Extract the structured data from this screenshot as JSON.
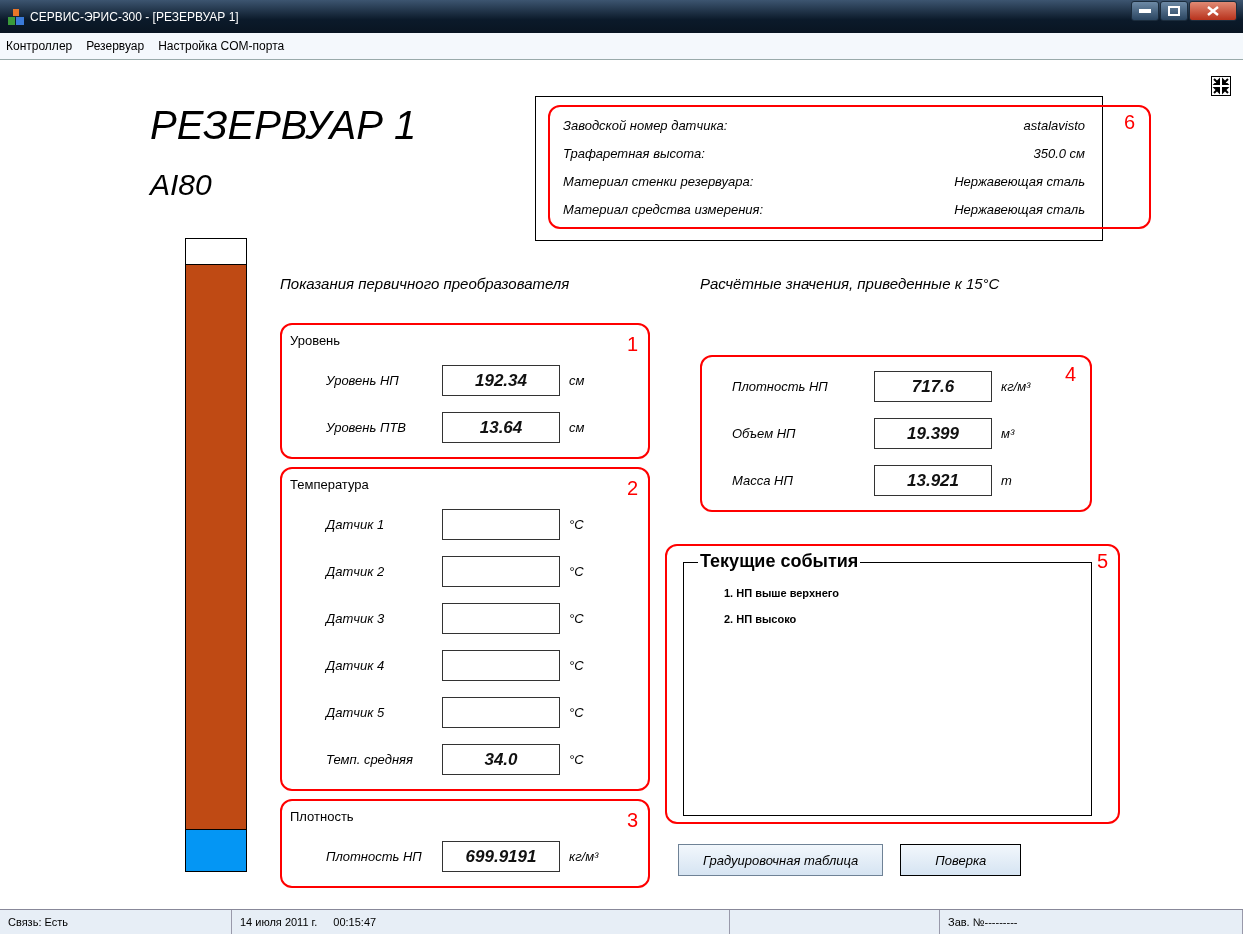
{
  "window": {
    "title": "СЕРВИС-ЭРИС-300 - [РЕЗЕРВУАР 1]"
  },
  "menu": [
    "Контроллер",
    "Резервуар",
    "Настройка COM-порта"
  ],
  "tank": {
    "title": "РЕЗЕРВУАР 1",
    "subtitle": "AI80",
    "product": {
      "level": 0.96
    },
    "water": {
      "level": 0.066
    }
  },
  "info": {
    "annotation": "6",
    "rows": [
      {
        "label": "Заводской номер датчика:",
        "value": "astalavisto"
      },
      {
        "label": "Трафаретная высота:",
        "value": "350.0 см"
      },
      {
        "label": "Материал стенки резервуара:",
        "value": "Нержавеющая сталь"
      },
      {
        "label": "Материал средства измерения:",
        "value": "Нержавеющая сталь"
      }
    ]
  },
  "primary": {
    "caption": "Показания первичного преобразователя",
    "groups": [
      {
        "title": "Уровень",
        "annotation": "1",
        "rows": [
          {
            "label": "Уровень НП",
            "value": "192.34",
            "unit": "см"
          },
          {
            "label": "Уровень ПТВ",
            "value": "13.64",
            "unit": "см"
          }
        ]
      },
      {
        "title": "Температура",
        "annotation": "2",
        "rows": [
          {
            "label": "Датчик 1",
            "unit": "°C"
          },
          {
            "label": "Датчик 2",
            "unit": "°C"
          },
          {
            "label": "Датчик 3",
            "unit": "°C"
          },
          {
            "label": "Датчик 4",
            "unit": "°C"
          },
          {
            "label": "Датчик 5",
            "unit": "°C"
          },
          {
            "label": "Темп. средняя",
            "value": "34.0",
            "unit": "°C"
          }
        ]
      },
      {
        "title": "Плотность",
        "annotation": "3",
        "rows": [
          {
            "label": "Плотность НП",
            "value": "699.9191",
            "unit": "кг/м³"
          }
        ]
      }
    ]
  },
  "calculated": {
    "caption": "Расчётные значения, приведенные к 15°C",
    "annotation": "4",
    "rows": [
      {
        "label": "Плотность НП",
        "value": "717.6",
        "unit": "кг/м³"
      },
      {
        "label": "Объем НП",
        "value": "19.399",
        "unit": "м³"
      },
      {
        "label": "Масса НП",
        "value": "13.921",
        "unit": "т"
      }
    ]
  },
  "events": {
    "title": "Текущие события",
    "annotation": "5",
    "items": [
      "1. НП выше верхнего",
      "2. НП высоко"
    ]
  },
  "buttons": [
    "Градуировочная таблица",
    "Поверка"
  ],
  "status_bar": {
    "connection": "Связь: Есть",
    "date": "14 июля 2011 г.",
    "time": "00:15:47",
    "serial": "Зав. №---------"
  }
}
